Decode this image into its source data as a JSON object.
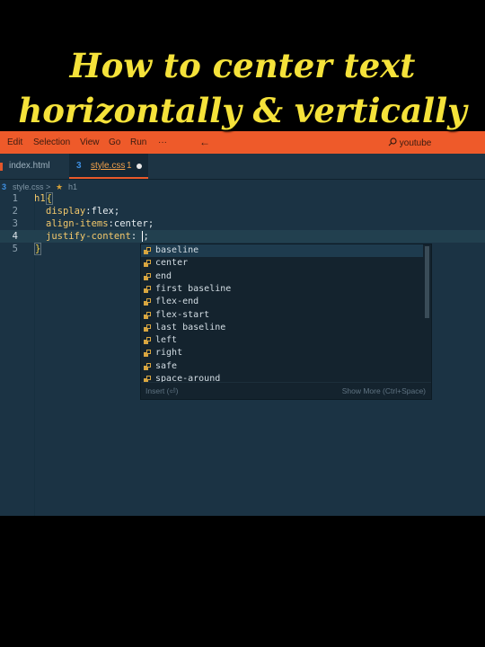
{
  "headline": {
    "line1": "How to center text",
    "line2": "horizontally & vertically"
  },
  "menubar": {
    "items": [
      "Edit",
      "Selection",
      "View",
      "Go",
      "Run",
      "···"
    ],
    "back_icon": "←",
    "search_placeholder": "youtube"
  },
  "tabs": [
    {
      "label": "index.html"
    },
    {
      "label": "style.css",
      "problems": "1"
    }
  ],
  "breadcrumb": {
    "file": "style.css",
    "separator": ">",
    "symbol": "h1"
  },
  "code": {
    "lines": [
      {
        "n": "1"
      },
      {
        "n": "2",
        "prop": "display",
        "colon": ":",
        "value": "flex",
        "end": ";"
      },
      {
        "n": "3",
        "prop": "align-items",
        "colon": ":",
        "value": "center",
        "end": ";"
      },
      {
        "n": "4",
        "prop": "justify-content",
        "colon": ":",
        "value": " ",
        "end": ";"
      },
      {
        "n": "5"
      }
    ],
    "selector": "h1",
    "open_brace": "{",
    "close_brace": "}"
  },
  "suggestions": {
    "items": [
      "baseline",
      "center",
      "end",
      "first baseline",
      "flex-end",
      "flex-start",
      "last baseline",
      "left",
      "right",
      "safe",
      "space-around"
    ],
    "selected_index": 0,
    "footer_insert": "Insert (⏎)",
    "footer_more": "Show More (Ctrl+Space)"
  },
  "colors": {
    "accent": "#ee5a2a",
    "editor_bg": "#1b3344",
    "headline": "#f5e23a"
  }
}
